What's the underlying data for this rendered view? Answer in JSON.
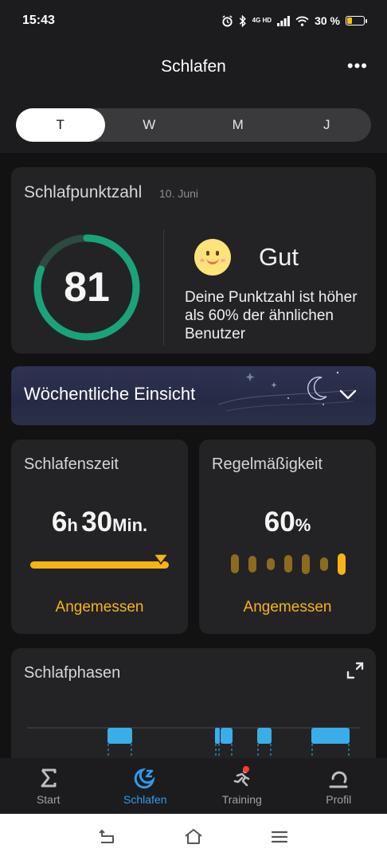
{
  "status_bar": {
    "time": "15:43",
    "network": "4G HD",
    "battery_text": "30 %",
    "battery_level": 0.3,
    "icons": [
      "alarm-icon",
      "bluetooth-icon",
      "signal-icon",
      "wifi-icon",
      "battery-icon"
    ]
  },
  "header": {
    "title": "Schlafen",
    "more_label": "•••"
  },
  "period_tabs": [
    {
      "label": "T",
      "active": true
    },
    {
      "label": "W",
      "active": false
    },
    {
      "label": "M",
      "active": false
    },
    {
      "label": "J",
      "active": false
    }
  ],
  "score_card": {
    "title": "Schlafpunktzahl",
    "date": "10. Juni",
    "score": "81",
    "score_value": 81,
    "score_max": 100,
    "rating": "Gut",
    "description": "Deine Punktzahl ist höher als 60% der ähnlichen Benutzer",
    "ring_color": "#1aa37a",
    "ring_track_color": "#2b4a40"
  },
  "insight": {
    "title": "Wöchentliche Einsicht"
  },
  "sleep_time": {
    "title": "Schlafenszeit",
    "hours": "6",
    "hours_unit": "h",
    "minutes": "30",
    "minutes_unit": "Min.",
    "status": "Angemessen",
    "accent": "#f8b416"
  },
  "regularity": {
    "title": "Regelmäßigkeit",
    "value": "60",
    "unit": "%",
    "status": "Angemessen",
    "day_bars": [
      0.85,
      0.75,
      0.55,
      0.8,
      0.9,
      0.6,
      0.95
    ],
    "accent": "#f8b416"
  },
  "sleep_phases": {
    "title": "Schlafphasen",
    "phase_color": "#3aaee8"
  },
  "bottom_nav": [
    {
      "label": "Start",
      "icon": "sigma-icon",
      "active": false
    },
    {
      "label": "Schlafen",
      "icon": "moon-z-icon",
      "active": true
    },
    {
      "label": "Training",
      "icon": "running-icon",
      "active": false
    },
    {
      "label": "Profil",
      "icon": "profile-icon",
      "active": false
    }
  ]
}
